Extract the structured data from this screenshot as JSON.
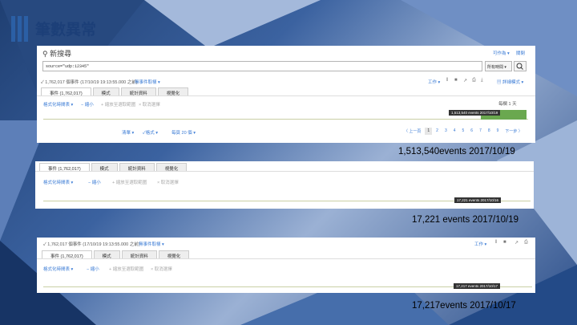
{
  "slide": {
    "title": "筆數異常"
  },
  "panel1": {
    "header_right_1": "可作為 ▾",
    "header_right_2": "關閉",
    "search_heading": "新搜尋",
    "search_query": "source=\"udp:12345\"",
    "time_picker": "所有時間 ▾",
    "event_summary": "✓ 1,762,017 個事件 (17/10/19 19:13:55.000 之前)",
    "sampling": "無事件取樣 ▾",
    "job_menu": "工作 ▾",
    "smart_mode": "▤ 詳細模式 ▾",
    "tabs": [
      "事件 (1,762,017)",
      "模式",
      "統計資料",
      "視覺化"
    ],
    "format_timeline": "格式化時間表 ▾",
    "zoom_out": "− 縮小",
    "zoom_selection": "+ 縮放至選取範圍",
    "deselect": "× 取消選擇",
    "scale_label": "每欄 1 天",
    "tooltip": "1,513,540 events 2017/10/19",
    "list_btn": "清單 ▾",
    "format_btn": "✓格式 ▾",
    "per_page": "每頁 20 個 ▾",
    "prev": "〈 上一頁",
    "pages": [
      "1",
      "2",
      "3",
      "4",
      "5",
      "6",
      "7",
      "8",
      "9"
    ],
    "next": "下一步 〉"
  },
  "caption1": "1,513,540events 2017/10/19",
  "panel2": {
    "tabs": [
      "事件 (1,762,017)",
      "模式",
      "統計資料",
      "視覺化"
    ],
    "format_timeline": "格式化時間表 ▾",
    "zoom_out": "− 縮小",
    "zoom_selection": "+ 縮放至選取範圍",
    "deselect": "× 取消選擇",
    "tooltip": "17,221 events 2017/10/16"
  },
  "caption2": "17,221 events 2017/10/19",
  "panel3": {
    "event_summary": "✓ 1,762,017 個事件 (17/10/19 19:13:55.000 之前)",
    "sampling": "無事件取樣 ▾",
    "job_menu": "工作 ▾",
    "tabs": [
      "事件 (1,762,017)",
      "模式",
      "統計資料",
      "視覺化"
    ],
    "format_timeline": "格式化時間表 ▾",
    "zoom_out": "− 縮小",
    "zoom_selection": "+ 縮放至選取範圍",
    "deselect": "× 取消選擇",
    "tooltip": "17,217 events 2017/10/17"
  },
  "caption3": "17,217events 2017/10/17"
}
